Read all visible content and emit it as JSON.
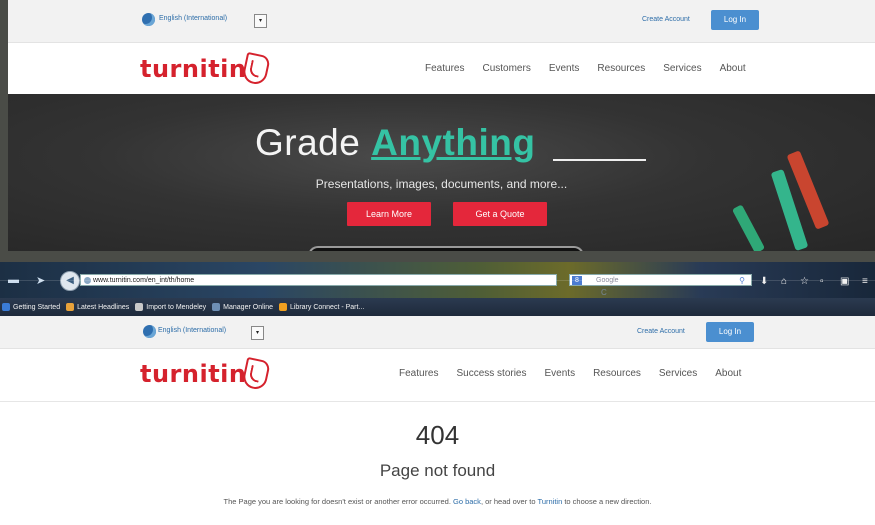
{
  "top_screenshot": {
    "language": "English (International)",
    "create_account": "Create Account",
    "login": "Log In",
    "logo": "turnitin",
    "nav": [
      "Features",
      "Customers",
      "Events",
      "Resources",
      "Services",
      "About"
    ],
    "hero": {
      "title_prefix": "Grade",
      "title_highlight": "Anything",
      "subtitle": "Presentations, images, documents, and more...",
      "learn_more": "Learn More",
      "get_quote": "Get a Quote"
    },
    "colors": {
      "brand_red": "#d5222d",
      "accent_teal": "#35c3a4",
      "cta_red": "#e4273b",
      "login_blue": "#4b8fd0"
    }
  },
  "bottom_screenshot": {
    "browser": {
      "url": "www.turnitin.com/en_int/th/home",
      "search_placeholder": "Google",
      "bookmarks": [
        "Getting Started",
        "Latest Headlines",
        "Import to Mendeley",
        "Manager Online",
        "Library Connect - Part..."
      ]
    },
    "language": "English (International)",
    "create_account": "Create Account",
    "login": "Log In",
    "logo": "turnitin",
    "nav": [
      "Features",
      "Success stories",
      "Events",
      "Resources",
      "Services",
      "About"
    ],
    "error": {
      "code": "404",
      "title": "Page not found",
      "message_before": "The Page you are looking for doesn't exist or another error occurred.",
      "go_back": "Go back",
      "message_middle": ", or head over to",
      "turnitin_link": "Turnitin",
      "message_after": "to choose a new direction."
    }
  }
}
